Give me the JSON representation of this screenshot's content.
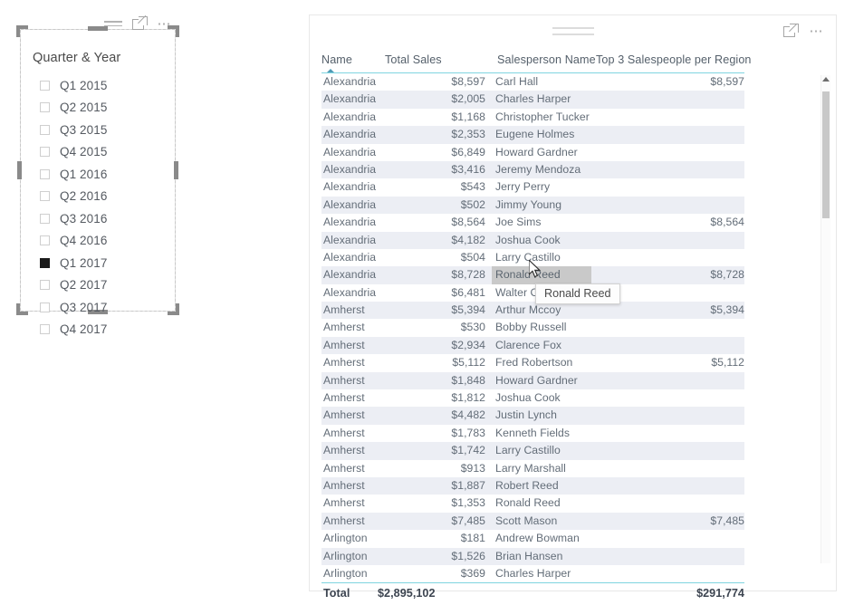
{
  "slicer": {
    "title": "Quarter & Year",
    "icons": {
      "filter": "filter-icon",
      "focus": "focus-mode-icon",
      "more": "more-options-icon"
    },
    "items": [
      {
        "label": "Q1 2015",
        "checked": false
      },
      {
        "label": "Q2 2015",
        "checked": false
      },
      {
        "label": "Q3 2015",
        "checked": false
      },
      {
        "label": "Q4 2015",
        "checked": false
      },
      {
        "label": "Q1 2016",
        "checked": false
      },
      {
        "label": "Q2 2016",
        "checked": false
      },
      {
        "label": "Q3 2016",
        "checked": false
      },
      {
        "label": "Q4 2016",
        "checked": false
      },
      {
        "label": "Q1 2017",
        "checked": true
      },
      {
        "label": "Q2 2017",
        "checked": false
      },
      {
        "label": "Q3 2017",
        "checked": false
      },
      {
        "label": "Q4 2017",
        "checked": false
      }
    ]
  },
  "table": {
    "icons": {
      "focus": "focus-mode-icon",
      "more": "more-options-icon",
      "drag": "drag-handle-icon"
    },
    "sort_column": "Name",
    "sort_direction": "ascending",
    "columns": [
      "Name",
      "Total Sales",
      "Salesperson Name",
      "Top 3 Salespeople per Region"
    ],
    "rows": [
      {
        "name": "Alexandria",
        "total": "$8,597",
        "person": "Carl Hall",
        "top3": "$8,597"
      },
      {
        "name": "Alexandria",
        "total": "$2,005",
        "person": "Charles Harper",
        "top3": ""
      },
      {
        "name": "Alexandria",
        "total": "$1,168",
        "person": "Christopher Tucker",
        "top3": ""
      },
      {
        "name": "Alexandria",
        "total": "$2,353",
        "person": "Eugene Holmes",
        "top3": ""
      },
      {
        "name": "Alexandria",
        "total": "$6,849",
        "person": "Howard Gardner",
        "top3": ""
      },
      {
        "name": "Alexandria",
        "total": "$3,416",
        "person": "Jeremy Mendoza",
        "top3": ""
      },
      {
        "name": "Alexandria",
        "total": "$543",
        "person": "Jerry Perry",
        "top3": ""
      },
      {
        "name": "Alexandria",
        "total": "$502",
        "person": "Jimmy Young",
        "top3": ""
      },
      {
        "name": "Alexandria",
        "total": "$8,564",
        "person": "Joe Sims",
        "top3": "$8,564"
      },
      {
        "name": "Alexandria",
        "total": "$4,182",
        "person": "Joshua Cook",
        "top3": ""
      },
      {
        "name": "Alexandria",
        "total": "$504",
        "person": "Larry Castillo",
        "top3": ""
      },
      {
        "name": "Alexandria",
        "total": "$8,728",
        "person": "Ronald Reed",
        "top3": "$8,728",
        "hovered": true
      },
      {
        "name": "Alexandria",
        "total": "$6,481",
        "person": "Walter Co",
        "top3": ""
      },
      {
        "name": "Amherst",
        "total": "$5,394",
        "person": "Arthur Mccoy",
        "top3": "$5,394"
      },
      {
        "name": "Amherst",
        "total": "$530",
        "person": "Bobby Russell",
        "top3": ""
      },
      {
        "name": "Amherst",
        "total": "$2,934",
        "person": "Clarence Fox",
        "top3": ""
      },
      {
        "name": "Amherst",
        "total": "$5,112",
        "person": "Fred Robertson",
        "top3": "$5,112"
      },
      {
        "name": "Amherst",
        "total": "$1,848",
        "person": "Howard Gardner",
        "top3": ""
      },
      {
        "name": "Amherst",
        "total": "$1,812",
        "person": "Joshua Cook",
        "top3": ""
      },
      {
        "name": "Amherst",
        "total": "$4,482",
        "person": "Justin Lynch",
        "top3": ""
      },
      {
        "name": "Amherst",
        "total": "$1,783",
        "person": "Kenneth Fields",
        "top3": ""
      },
      {
        "name": "Amherst",
        "total": "$1,742",
        "person": "Larry Castillo",
        "top3": ""
      },
      {
        "name": "Amherst",
        "total": "$913",
        "person": "Larry Marshall",
        "top3": ""
      },
      {
        "name": "Amherst",
        "total": "$1,887",
        "person": "Robert Reed",
        "top3": ""
      },
      {
        "name": "Amherst",
        "total": "$1,353",
        "person": "Ronald Reed",
        "top3": ""
      },
      {
        "name": "Amherst",
        "total": "$7,485",
        "person": "Scott Mason",
        "top3": "$7,485"
      },
      {
        "name": "Arlington",
        "total": "$181",
        "person": "Andrew Bowman",
        "top3": ""
      },
      {
        "name": "Arlington",
        "total": "$1,526",
        "person": "Brian Hansen",
        "top3": ""
      },
      {
        "name": "Arlington",
        "total": "$369",
        "person": "Charles Harper",
        "top3": ""
      }
    ],
    "total_row": {
      "label": "Total",
      "total": "$2,895,102",
      "person": "",
      "top3": "$291,774"
    },
    "scrollbar": {
      "up_arrow": "scroll-up-arrow-icon"
    }
  },
  "tooltip": {
    "text": "Ronald Reed"
  },
  "colors": {
    "accent_underline": "#7fd5e0",
    "alt_row": "#eceef4",
    "hover_cell": "#c9c9c9",
    "text": "#636d78",
    "selected_checkbox": "#1a1a1a"
  }
}
